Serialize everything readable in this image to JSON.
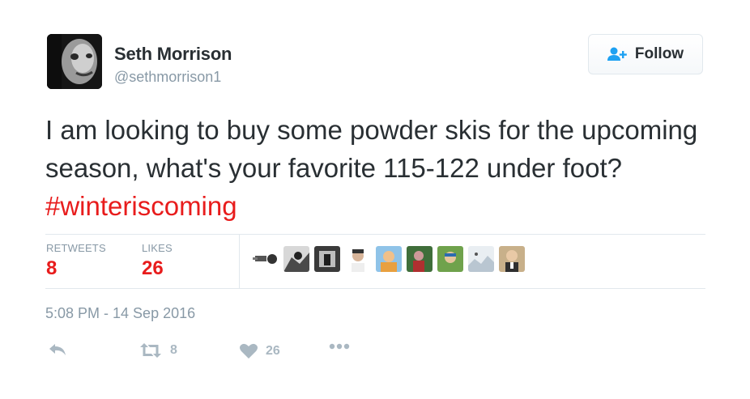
{
  "user": {
    "name": "Seth Morrison",
    "handle": "@sethmorrison1"
  },
  "follow": {
    "label": "Follow"
  },
  "tweet": {
    "text": "I am looking to buy some powder skis for the upcoming season, what's your favorite 115-122 under foot?",
    "hashtag": "#winteriscoming"
  },
  "stats": {
    "retweets_label": "RETWEETS",
    "retweets_value": "8",
    "likes_label": "LIKES",
    "likes_value": "26"
  },
  "timestamp": "5:08 PM - 14 Sep 2016",
  "actions": {
    "retweet_count": "8",
    "like_count": "26"
  },
  "colors": {
    "accent": "#e81c1c",
    "muted": "#8899a6",
    "text": "#292f33",
    "icon": "#aab8c2",
    "follow_icon": "#1da1f2"
  }
}
